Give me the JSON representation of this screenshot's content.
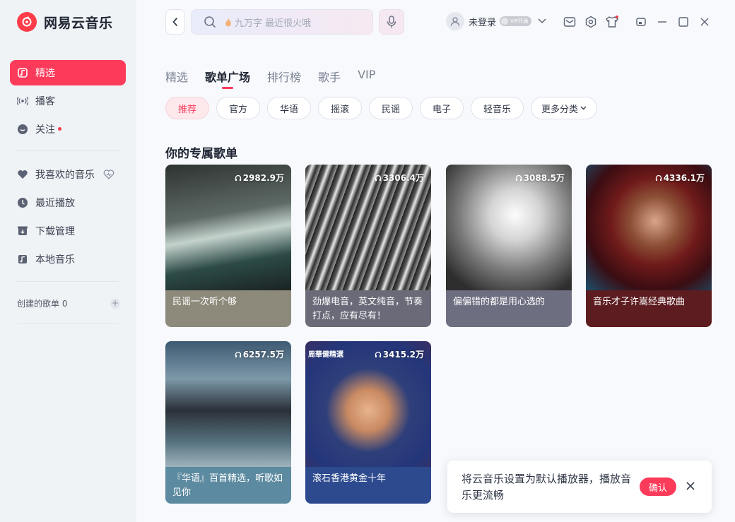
{
  "app": {
    "name": "网易云音乐"
  },
  "sidebar": {
    "primary": [
      {
        "label": "精选",
        "active": true
      },
      {
        "label": "播客"
      },
      {
        "label": "关注",
        "has_dot": true
      }
    ],
    "library": [
      {
        "label": "我喜欢的音乐"
      },
      {
        "label": "最近播放"
      },
      {
        "label": "下载管理"
      },
      {
        "label": "本地音乐"
      }
    ],
    "created_playlists": "创建的歌单 0"
  },
  "topbar": {
    "search_placeholder": "九万字 最近很火哦",
    "login_text": "未登录",
    "vip_badge": "VIP开通"
  },
  "tabs": [
    {
      "label": "精选"
    },
    {
      "label": "歌单广场",
      "active": true
    },
    {
      "label": "排行榜"
    },
    {
      "label": "歌手"
    },
    {
      "label": "VIP"
    }
  ],
  "chips": [
    {
      "label": "推荐",
      "active": true
    },
    {
      "label": "官方"
    },
    {
      "label": "华语"
    },
    {
      "label": "摇滚"
    },
    {
      "label": "民谣"
    },
    {
      "label": "电子"
    },
    {
      "label": "轻音乐"
    },
    {
      "label": "更多分类"
    }
  ],
  "section_title": "你的专属歌单",
  "playlists": [
    {
      "plays": "2982.9万",
      "title": "民谣一次听个够"
    },
    {
      "plays": "3306.4万",
      "title": "劲爆电音，英文纯音，节奏打点，应有尽有！"
    },
    {
      "plays": "3088.5万",
      "title": "偏偏错的都是用心选的"
    },
    {
      "plays": "4336.1万",
      "title": "音乐才子许嵩经典歌曲"
    },
    {
      "plays": "6257.5万",
      "title": "『华语』百首精选，听歌如见你"
    },
    {
      "plays": "3415.2万",
      "title": "滚石香港黄金十年",
      "cover_tag": "周華健精選"
    }
  ],
  "toast": {
    "message": "将云音乐设置为默认播放器，播放音乐更流畅",
    "confirm_label": "确认"
  },
  "colors": {
    "accent": "#fc3b5b",
    "sidebar_bg": "#f0f3f6",
    "page_bg": "#f7f9fc"
  }
}
